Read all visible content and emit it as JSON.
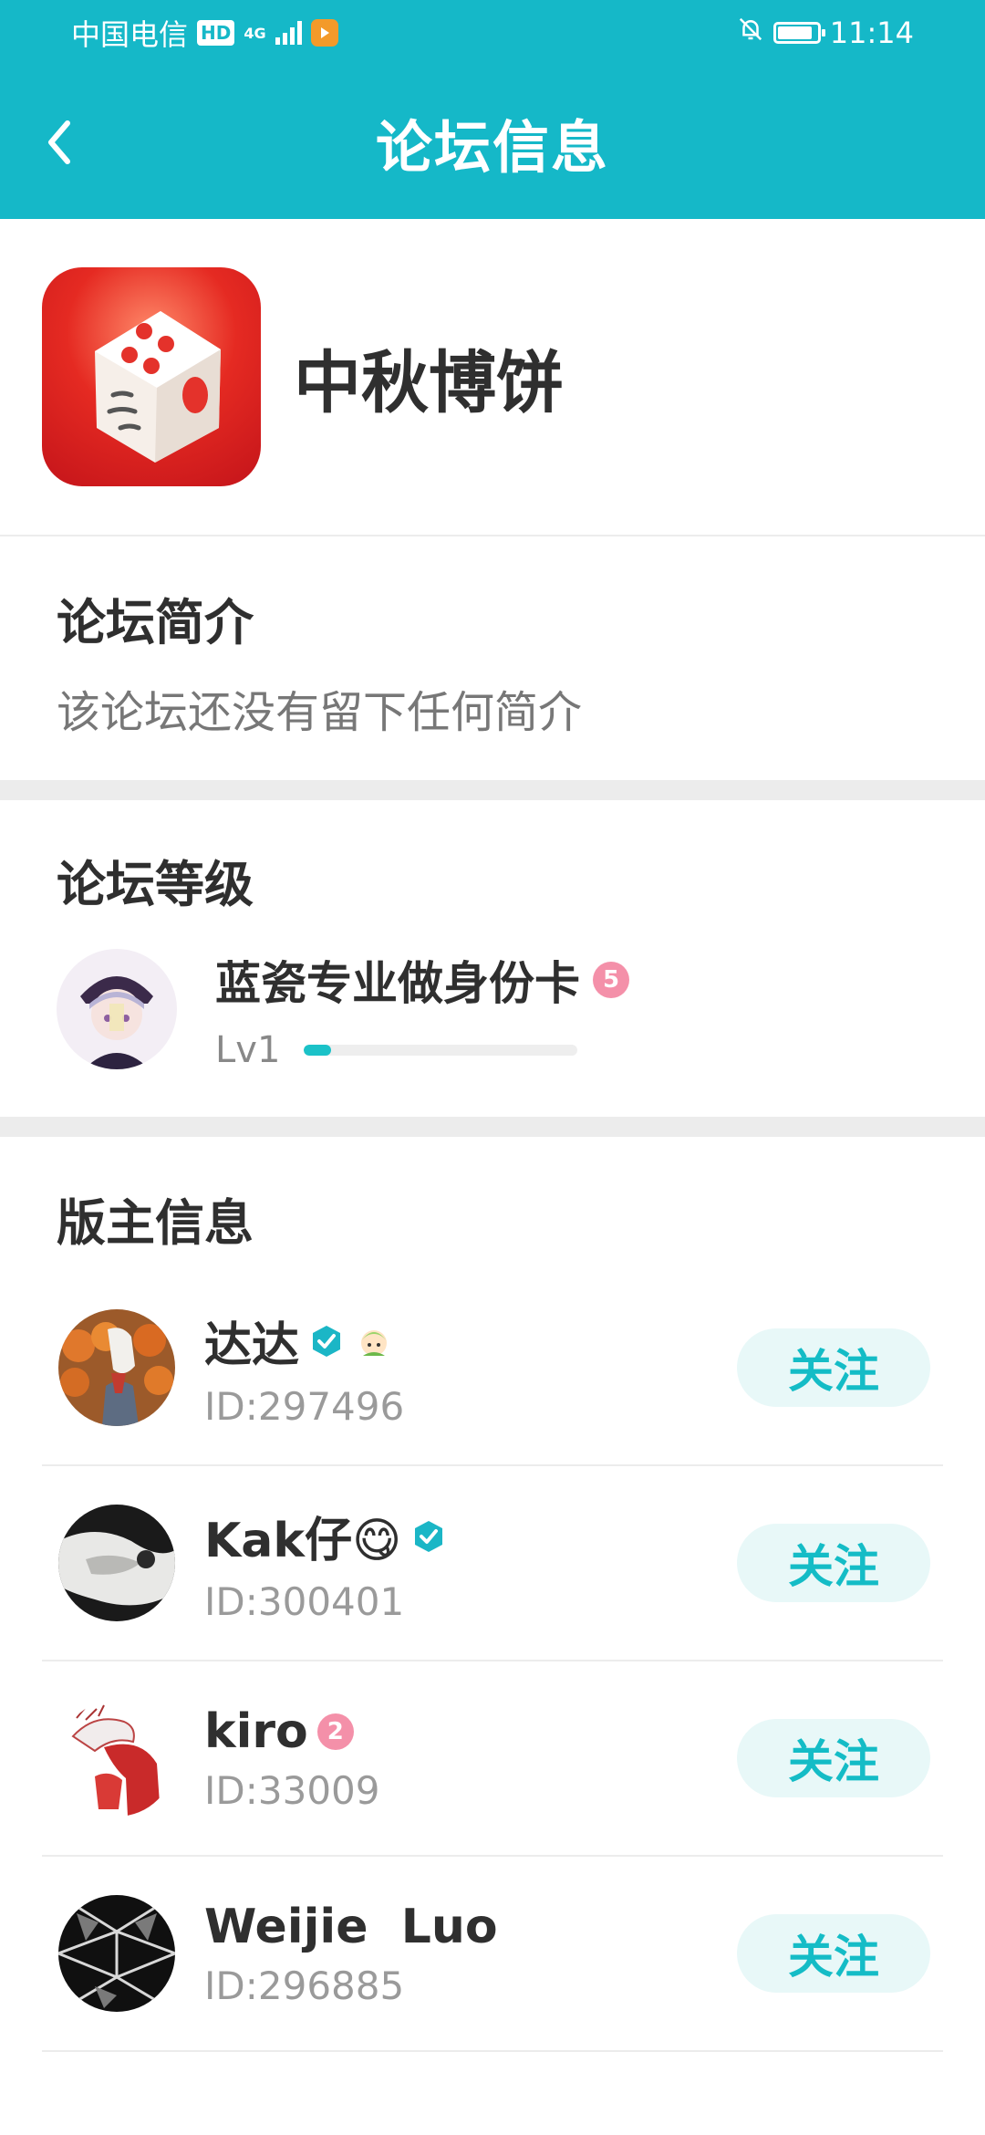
{
  "status_bar": {
    "carrier": "中国电信",
    "hd": "HD",
    "network": "4G",
    "time": "11:14",
    "battery_level": 0.9
  },
  "nav": {
    "title": "论坛信息"
  },
  "forum": {
    "name": "中秋博饼"
  },
  "intro": {
    "title": "论坛简介",
    "text": "该论坛还没有留下任何简介"
  },
  "level": {
    "title": "论坛等级",
    "user_name": "蓝瓷专业做身份卡",
    "user_badge": "5",
    "lv_label": "Lv1",
    "progress": 0.1
  },
  "moderators": {
    "title": "版主信息",
    "follow_label": "关注",
    "items": [
      {
        "name": "达达",
        "id": "ID:297496"
      },
      {
        "name": "Kak仔😋",
        "id": "ID:300401"
      },
      {
        "name": "kiro",
        "id": "ID:33009",
        "badge": "2"
      },
      {
        "name": "Weijie  Luo",
        "id": "ID:296885"
      }
    ]
  },
  "colors": {
    "accent": "#15b8c8",
    "follow_bg": "#e8f8f8",
    "verified": "#1bb6c6",
    "level_badge": "#f490a9"
  },
  "icons": {
    "back": "chevron-left-icon",
    "verified": "verified-check-icon"
  }
}
